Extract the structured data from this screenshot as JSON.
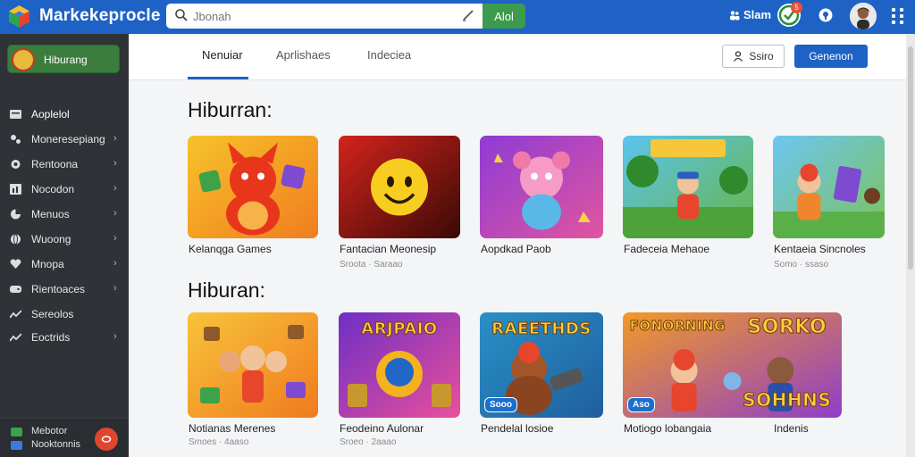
{
  "app": {
    "title": "Markekeprocle"
  },
  "search": {
    "placeholder": "Jbonah",
    "button_label": "Alol"
  },
  "topbar": {
    "signin_label": "Slam",
    "badge_count": "5"
  },
  "sidebar": {
    "badge_label": "Hiburang",
    "items": [
      {
        "label": "Aoplelol",
        "icon": "apps-icon",
        "chevron": false
      },
      {
        "label": "Moneresepiang",
        "icon": "tag-icon",
        "chevron": true
      },
      {
        "label": "Rentoona",
        "icon": "circle-icon",
        "chevron": true
      },
      {
        "label": "Nocodon",
        "icon": "chart-icon",
        "chevron": true
      },
      {
        "label": "Menuos",
        "icon": "pie-icon",
        "chevron": true
      },
      {
        "label": "Wuoong",
        "icon": "globe-icon",
        "chevron": true
      },
      {
        "label": "Mnopa",
        "icon": "heart-icon",
        "chevron": true
      },
      {
        "label": "Rientoaces",
        "icon": "gamepad-icon",
        "chevron": true
      },
      {
        "label": "Sereolos",
        "icon": "trend-icon",
        "chevron": false
      },
      {
        "label": "Eoctrids",
        "icon": "trend-icon",
        "chevron": true
      }
    ],
    "footer": {
      "line1": "Mebotor",
      "line2": "Nooktonnis",
      "record_label": "rec"
    }
  },
  "header": {
    "tabs": [
      {
        "label": "Nenuiar",
        "active": true
      },
      {
        "label": "Aprlishaes",
        "active": false
      },
      {
        "label": "Indeciea",
        "active": false
      }
    ],
    "outline_button": "Ssiro",
    "primary_button": "Genenon"
  },
  "sections": [
    {
      "title": "Hiburran:",
      "cards": [
        {
          "name": "Kelanqga Games",
          "meta": "",
          "art": "fox"
        },
        {
          "name": "Fantacian Meonesip",
          "meta": "Sroota · Saraao",
          "art": "smiley"
        },
        {
          "name": "Aopdkad Paob",
          "meta": "",
          "art": "pink"
        },
        {
          "name": "Fadeceia Mehaoe",
          "meta": "",
          "art": "jungle"
        },
        {
          "name": "Kentaeia Sincnoles",
          "meta": "Somo · ssaso",
          "art": "kids"
        }
      ]
    },
    {
      "title": "Hiburan:",
      "cards": [
        {
          "name": "Notianas Merenes",
          "meta": "Smoes · 4aaso",
          "art": "family",
          "tag": ""
        },
        {
          "name": "Feodeino Aulonar",
          "meta": "Sroeo · 2aaao",
          "art": "bird",
          "banner": "ARJPAIO",
          "tag": ""
        },
        {
          "name": "Pendelal losioe",
          "meta": "",
          "art": "bear",
          "banner": "RAEETHDS",
          "tag": "Sooo"
        },
        {
          "name": "Motiogo lobangaia",
          "meta": "",
          "art": "wide",
          "banner": "FONORNING",
          "banner2": "SORKO",
          "banner3": "SOHHNS",
          "tag": "Aso"
        },
        {
          "name": "Indenis",
          "meta": "",
          "art": "none"
        }
      ]
    }
  ],
  "colors": {
    "topbar": "#1e62c5",
    "sidebar": "#2f3237",
    "accent_green": "#3c9b4c",
    "primary": "#1e62c5"
  }
}
